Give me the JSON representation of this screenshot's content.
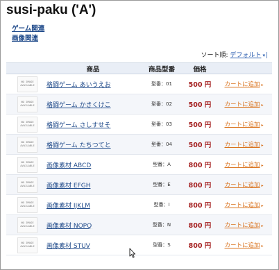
{
  "page": {
    "title": "susi-paku ('A')"
  },
  "categories": [
    "ゲーム関連",
    "画像関連"
  ],
  "sort": {
    "label": "ソート順:",
    "value": "デフォルト",
    "caret": "▾",
    "pipe": "|"
  },
  "table": {
    "headers": {
      "product": "商品",
      "model": "商品型番",
      "price": "価格"
    },
    "thumbnail_text": "NO IMAGE AVAILABLE",
    "cart_arrow": "▸",
    "rows": [
      {
        "name": "格闘ゲーム あいうえお",
        "model": "型番：01",
        "price": "500 円",
        "cart": "カートに追加"
      },
      {
        "name": "格闘ゲーム かきくけこ",
        "model": "型番：02",
        "price": "500 円",
        "cart": "カートに追加"
      },
      {
        "name": "格闘ゲーム さしすせそ",
        "model": "型番：03",
        "price": "500 円",
        "cart": "カートに追加"
      },
      {
        "name": "格闘ゲーム たちつてと",
        "model": "型番：04",
        "price": "500 円",
        "cart": "カートに追加"
      },
      {
        "name": "画像素材 ABCD",
        "model": "型番：A",
        "price": "800 円",
        "cart": "カートに追加"
      },
      {
        "name": "画像素材 EFGH",
        "model": "型番：E",
        "price": "800 円",
        "cart": "カートに追加"
      },
      {
        "name": "画像素材 IJKLM",
        "model": "型番：I",
        "price": "800 円",
        "cart": "カートに追加"
      },
      {
        "name": "画像素材 NOPQ",
        "model": "型番：N",
        "price": "800 円",
        "cart": "カートに追加"
      },
      {
        "name": "画像素材 STUV",
        "model": "型番：S",
        "price": "800 円",
        "cart": "カートに追加"
      }
    ]
  },
  "icons": {
    "cursor": "mouse-pointer-icon"
  }
}
